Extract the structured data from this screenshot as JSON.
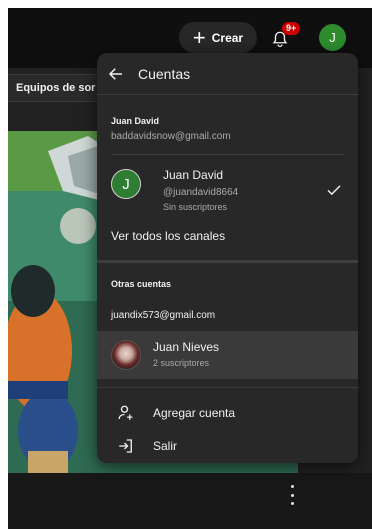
{
  "topbar": {
    "create_label": "Crear",
    "notification_badge": "9+",
    "avatar_initial": "J"
  },
  "page": {
    "section_heading": "Equipos de sor"
  },
  "menu": {
    "title": "Cuentas",
    "current_section": {
      "name": "Juan David",
      "email": "baddavidsnow@gmail.com"
    },
    "current_account": {
      "initial": "J",
      "name": "Juan David",
      "handle": "@juandavid8664",
      "subscribers": "Sin suscriptores",
      "selected": true
    },
    "view_all_label": "Ver todos los canales",
    "other_heading": "Otras cuentas",
    "other_email": "juandix573@gmail.com",
    "other_account": {
      "name": "Juan Nieves",
      "subscribers": "2 suscriptores"
    },
    "actions": [
      {
        "label": "Agregar cuenta",
        "icon": "add-account-icon"
      },
      {
        "label": "Salir",
        "icon": "sign-out-icon"
      }
    ]
  },
  "colors": {
    "badge": "#cc0000",
    "avatar": "#2e8b2e",
    "menu_bg": "#282828",
    "highlight": "#3a3a3a"
  }
}
